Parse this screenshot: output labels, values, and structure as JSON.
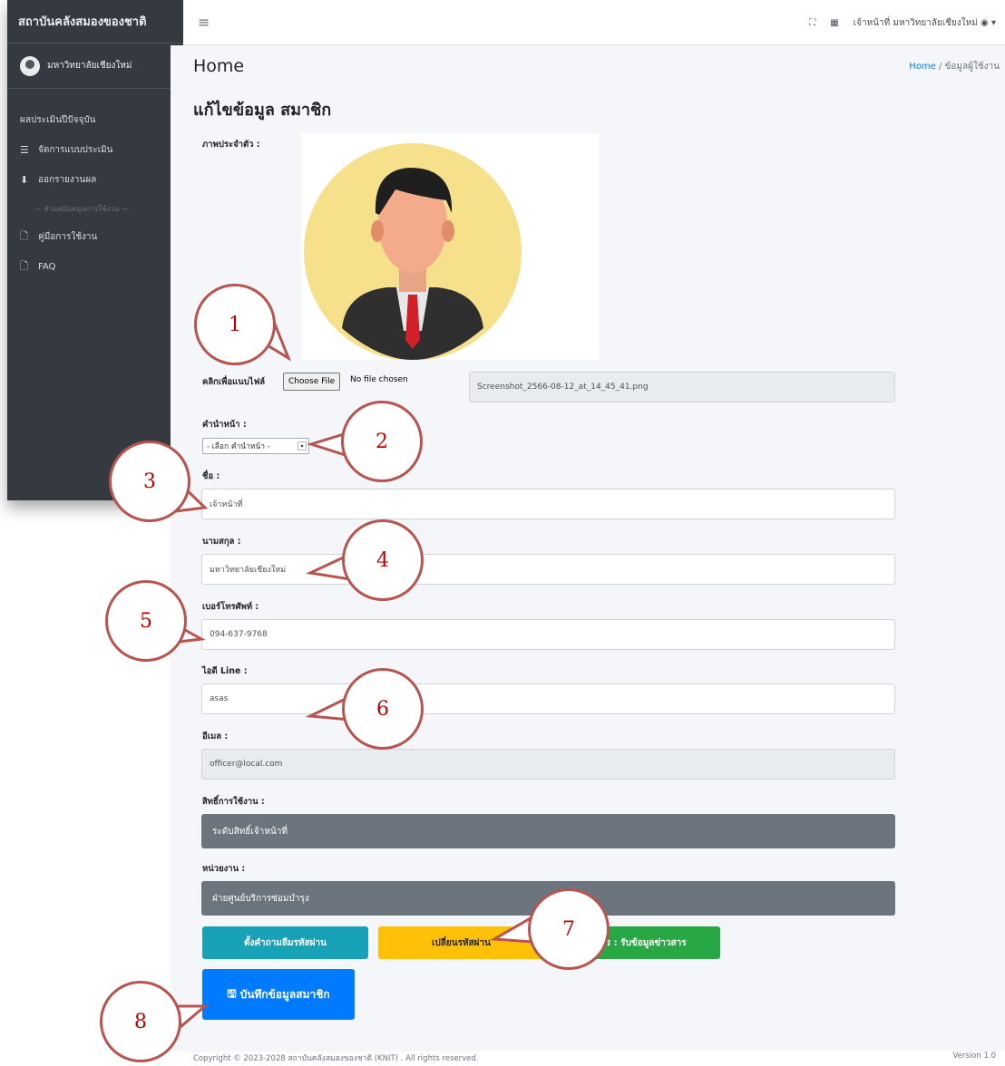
{
  "sidebar": {
    "brand": "สถาบันคลังสมองของชาติ",
    "user": "มหาวิทยาลัยเชียงใหม่",
    "items": [
      {
        "label": "ผลประเมินปีปัจจุบัน",
        "icon": ""
      },
      {
        "label": "จัดการแบบประเมิน",
        "icon": "list-icon"
      },
      {
        "label": "ออกรายงานผล",
        "icon": "download-icon"
      },
      {
        "label": "— ส่วนสนับสนุนการใช้งาน —",
        "icon": ""
      },
      {
        "label": "คู่มือการใช้งาน",
        "icon": "file-icon"
      },
      {
        "label": "FAQ",
        "icon": "file-icon"
      }
    ]
  },
  "topbar": {
    "user_label": "เจ้าหน้าที่ มหาวิทยาลัยเชียงใหม่"
  },
  "page": {
    "title": "Home",
    "breadcrumb_home": "Home",
    "breadcrumb_current": "ข้อมูลผู้ใช้งาน",
    "section_title": "แก้ไขข้อมูล สมาชิก"
  },
  "form": {
    "photo_label": "ภาพประจำตัว :",
    "file_label": "คลิกเพื่อแนบไฟล์",
    "file_button": "Choose File",
    "file_status": "No file chosen",
    "file_name": "Screenshot_2566-08-12_at_14_45_41.png",
    "prefix_label": "คำนำหน้า :",
    "prefix_value": "- เลือก คำนำหน้า -",
    "firstname_label": "ชื่อ :",
    "firstname_value": "เจ้าหน้าที่",
    "lastname_label": "นามสกุล :",
    "lastname_value": "มหาวิทยาลัยเชียงใหม่",
    "phone_label": "เบอร์โทรศัพท์ :",
    "phone_value": "094-637-9768",
    "line_label": "ไอดี Line :",
    "line_value": "asas",
    "email_label": "อีเมล :",
    "email_value": "officer@local.com",
    "role_label": "สิทธิ์การใช้งาน :",
    "role_value": "ระดับสิทธิ์เจ้าหน้าที่",
    "unit_label": "หน่วยงาน :",
    "unit_value": "ฝ่ายศูนย์บริการซ่อมบำรุง"
  },
  "buttons": {
    "security_question": "ตั้งคำถามลืมรหัสผ่าน",
    "change_password": "เปลี่ยนรหัสผ่าน",
    "newsletter": "สมัคร : รับข้อมูลข่าวสาร",
    "save": "บันทึกข้อมูลสมาชิก"
  },
  "footer": {
    "copyright": "Copyright © 2023-2028 สถาบันคลังสมองของชาติ (KNIT) . All rights reserved.",
    "version": "Version 1.0"
  },
  "callouts": [
    "1",
    "2",
    "3",
    "4",
    "5",
    "6",
    "7",
    "8"
  ],
  "colors": {
    "sidebar": "#343a40",
    "primary": "#007bff",
    "info": "#17a2b8",
    "warning": "#ffc107",
    "success": "#28a745",
    "secondary": "#6c757d",
    "callout": "#b85450"
  }
}
